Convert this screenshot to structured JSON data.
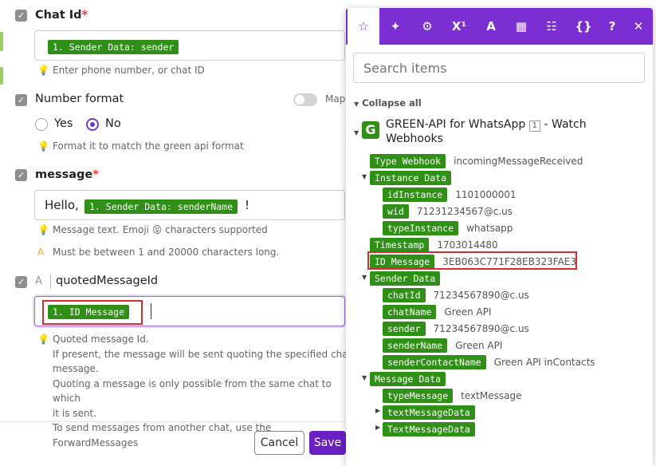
{
  "form": {
    "chat_id": {
      "label": "Chat Id",
      "required_mark": "*",
      "value_pill": "1. Sender Data: sender",
      "hint": "Enter phone number, or chat ID"
    },
    "number_format": {
      "label": "Number format",
      "map_label": "Map",
      "option_yes": "Yes",
      "option_no": "No",
      "selected": "No",
      "hint": "Format it to match the green api format"
    },
    "message": {
      "label": "message",
      "required_mark": "*",
      "prefix": "Hello,",
      "value_pill": "1. Sender Data: senderName",
      "suffix": "!",
      "hint1": "Message text. Emoji 😝 characters supported",
      "hint2": "Must be between 1 and 20000 characters long."
    },
    "quoted": {
      "type_icon": "A",
      "label": "quotedMessageId",
      "value_pill": "1. ID Message",
      "hint_lines": [
        "Quoted message Id.",
        "If present, the message will be sent quoting the specified chat",
        "message.",
        "Quoting a message is only possible from the same chat to which",
        "it is sent.",
        "To send messages from another chat, use the ForwardMessages"
      ]
    },
    "buttons": {
      "cancel": "Cancel",
      "save": "Save"
    }
  },
  "panel": {
    "tab_icons": [
      "star-icon",
      "sparkle-icon",
      "gear-icon",
      "superscript-icon",
      "text-icon",
      "calendar-icon",
      "table-icon",
      "braces-icon",
      "help-icon",
      "close-icon"
    ],
    "search_placeholder": "Search items",
    "collapse_all": "Collapse all",
    "module": {
      "title_a": "GREEN-API for WhatsApp",
      "badge": "1",
      "title_b": "- Watch",
      "title_c": "Webhooks"
    },
    "items": [
      {
        "key": "Type Webhook",
        "value": "incomingMessageReceived"
      },
      {
        "key": "Instance Data",
        "value": ""
      },
      {
        "key": "idInstance",
        "value": "1101000001"
      },
      {
        "key": "wid",
        "value": "71231234567@c.us"
      },
      {
        "key": "typeInstance",
        "value": "whatsapp"
      },
      {
        "key": "Timestamp",
        "value": "1703014480"
      },
      {
        "key": "ID Message",
        "value": "3EB063C771F28EB323FAE3"
      },
      {
        "key": "Sender Data",
        "value": ""
      },
      {
        "key": "chatId",
        "value": "71234567890@c.us"
      },
      {
        "key": "chatName",
        "value": "Green API"
      },
      {
        "key": "sender",
        "value": "71234567890@c.us"
      },
      {
        "key": "senderName",
        "value": "Green API"
      },
      {
        "key": "senderContactName",
        "value": "Green API inContacts"
      },
      {
        "key": "Message Data",
        "value": ""
      },
      {
        "key": "typeMessage",
        "value": "textMessage"
      },
      {
        "key": "textMessageData",
        "value": ""
      },
      {
        "key": "TextMessageData",
        "value": ""
      }
    ]
  },
  "colors": {
    "accent": "#7b2fd3",
    "pill": "#2f8f16",
    "highlight": "#d32f2f"
  }
}
